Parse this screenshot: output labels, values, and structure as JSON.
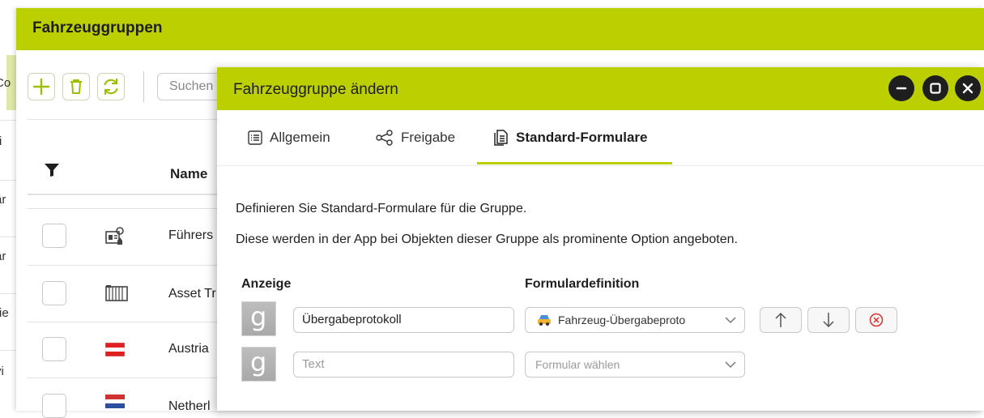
{
  "background_app": {
    "title": "Fahrzeuggruppen",
    "search_placeholder": "Suchen",
    "table_header_name": "Name",
    "rows": [
      {
        "name": "Führers",
        "icon": "license-card-icon"
      },
      {
        "name": "Asset Tr",
        "icon": "container-icon"
      },
      {
        "name": "Austria",
        "icon": "flag-austria-icon"
      },
      {
        "name": "Netherl",
        "icon": "flag-netherlands-icon"
      }
    ],
    "left_fragments": [
      "Co",
      "ri",
      "är",
      "är",
      "rie",
      "vi"
    ]
  },
  "modal": {
    "title": "Fahrzeuggruppe ändern",
    "tabs": [
      {
        "label": "Allgemein",
        "icon": "list-icon"
      },
      {
        "label": "Freigabe",
        "icon": "share-icon"
      },
      {
        "label": "Standard-Formulare",
        "icon": "document-icon",
        "active": true
      }
    ],
    "description_line1": "Definieren Sie Standard-Formulare für die Gruppe.",
    "description_line2": "Diese werden in der App bei Objekten dieser Gruppe als prominente Option angeboten.",
    "col_display": "Anzeige",
    "col_form": "Formulardefinition",
    "entries": [
      {
        "display_value": "Übergabeprotokoll",
        "form_value": "Fahrzeug-Übergabeproto",
        "form_icon": "car-icon"
      },
      {
        "display_placeholder": "Text",
        "form_placeholder": "Formular wählen"
      }
    ]
  },
  "colors": {
    "accent": "#bccf00",
    "danger": "#d9302c",
    "header_text": "#1e1e1e"
  }
}
